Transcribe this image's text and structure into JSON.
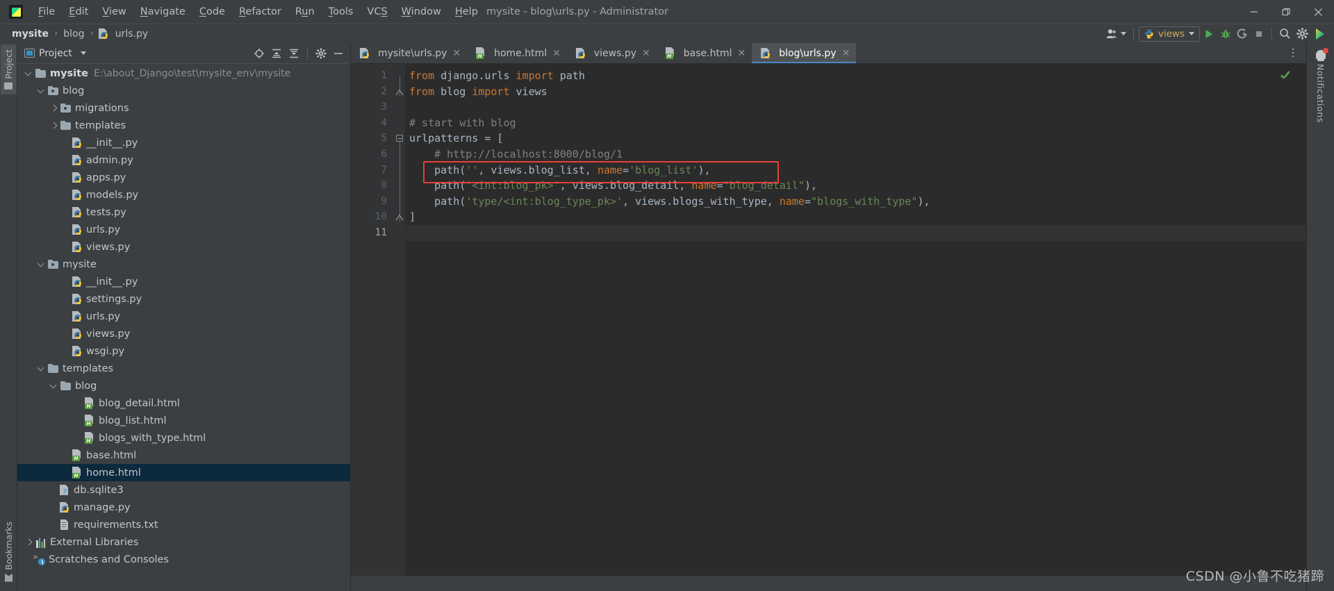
{
  "window": {
    "title": "mysite - blog\\urls.py - Administrator",
    "logo": "pycharm-logo",
    "controls": {
      "minimize": "—",
      "maximize": "❐",
      "close": "✕"
    }
  },
  "menu": [
    {
      "label": "File",
      "mnemonic": "F"
    },
    {
      "label": "Edit",
      "mnemonic": "E"
    },
    {
      "label": "View",
      "mnemonic": "V"
    },
    {
      "label": "Navigate",
      "mnemonic": "N"
    },
    {
      "label": "Code",
      "mnemonic": "C"
    },
    {
      "label": "Refactor",
      "mnemonic": "R"
    },
    {
      "label": "Run",
      "mnemonic": "u"
    },
    {
      "label": "Tools",
      "mnemonic": "T"
    },
    {
      "label": "VCS",
      "mnemonic": "S"
    },
    {
      "label": "Window",
      "mnemonic": "W"
    },
    {
      "label": "Help",
      "mnemonic": "H"
    }
  ],
  "breadcrumb": {
    "items": [
      "mysite",
      "blog",
      "urls.py"
    ],
    "separator": "›"
  },
  "toolbar": {
    "account_icon": "user-account-icon",
    "run_config": {
      "label": "views",
      "icon": "python-icon"
    },
    "run_icon": "run-icon",
    "debug_icon": "debug-bug-icon",
    "coverage_icon": "run-with-coverage-icon",
    "stop_icon": "stop-icon",
    "search_icon": "search-icon",
    "settings_icon": "settings-gear-icon",
    "updates_icon": "ide-updates-icon"
  },
  "left_stripe": {
    "top": {
      "label": "Project",
      "icon": "project-folder-icon",
      "active": true
    },
    "bottom": {
      "label": "Bookmarks",
      "icon": "bookmark-icon",
      "active": false
    }
  },
  "right_stripe": {
    "notifications": {
      "label": "Notifications",
      "icon": "bell-icon",
      "has_badge": true
    }
  },
  "project_panel": {
    "title": "Project",
    "title_icon": "project-view-icon",
    "actions": [
      {
        "name": "select-opened-file-icon",
        "glyph": "⊕"
      },
      {
        "name": "expand-all-icon",
        "glyph": "↑"
      },
      {
        "name": "collapse-all-icon",
        "glyph": "↓"
      },
      {
        "name": "options-gear-icon",
        "glyph": "⚙"
      },
      {
        "name": "hide-icon",
        "glyph": "—"
      }
    ],
    "tree": [
      {
        "label": "mysite",
        "path": "E:\\about_Django\\test\\mysite_env\\mysite",
        "indent": 0,
        "arrow": "down",
        "icon": "folder",
        "bold": true
      },
      {
        "label": "blog",
        "indent": 1,
        "arrow": "down",
        "icon": "folder-src"
      },
      {
        "label": "migrations",
        "indent": 2,
        "arrow": "right",
        "icon": "folder-src"
      },
      {
        "label": "templates",
        "indent": 2,
        "arrow": "right",
        "icon": "folder"
      },
      {
        "label": "__init__.py",
        "indent": 3,
        "arrow": "none",
        "icon": "python"
      },
      {
        "label": "admin.py",
        "indent": 3,
        "arrow": "none",
        "icon": "python"
      },
      {
        "label": "apps.py",
        "indent": 3,
        "arrow": "none",
        "icon": "python"
      },
      {
        "label": "models.py",
        "indent": 3,
        "arrow": "none",
        "icon": "python"
      },
      {
        "label": "tests.py",
        "indent": 3,
        "arrow": "none",
        "icon": "python"
      },
      {
        "label": "urls.py",
        "indent": 3,
        "arrow": "none",
        "icon": "python"
      },
      {
        "label": "views.py",
        "indent": 3,
        "arrow": "none",
        "icon": "python"
      },
      {
        "label": "mysite",
        "indent": 1,
        "arrow": "down",
        "icon": "folder-src"
      },
      {
        "label": "__init__.py",
        "indent": 3,
        "arrow": "none",
        "icon": "python"
      },
      {
        "label": "settings.py",
        "indent": 3,
        "arrow": "none",
        "icon": "python"
      },
      {
        "label": "urls.py",
        "indent": 3,
        "arrow": "none",
        "icon": "python"
      },
      {
        "label": "views.py",
        "indent": 3,
        "arrow": "none",
        "icon": "python"
      },
      {
        "label": "wsgi.py",
        "indent": 3,
        "arrow": "none",
        "icon": "python"
      },
      {
        "label": "templates",
        "indent": 1,
        "arrow": "down",
        "icon": "folder"
      },
      {
        "label": "blog",
        "indent": 2,
        "arrow": "down",
        "icon": "folder"
      },
      {
        "label": "blog_detail.html",
        "indent": 4,
        "arrow": "none",
        "icon": "html"
      },
      {
        "label": "blog_list.html",
        "indent": 4,
        "arrow": "none",
        "icon": "html"
      },
      {
        "label": "blogs_with_type.html",
        "indent": 4,
        "arrow": "none",
        "icon": "html"
      },
      {
        "label": "base.html",
        "indent": 3,
        "arrow": "none",
        "icon": "html"
      },
      {
        "label": "home.html",
        "indent": 3,
        "arrow": "none",
        "icon": "html",
        "selected": true
      },
      {
        "label": "db.sqlite3",
        "indent": 2,
        "arrow": "none",
        "icon": "db"
      },
      {
        "label": "manage.py",
        "indent": 2,
        "arrow": "none",
        "icon": "python"
      },
      {
        "label": "requirements.txt",
        "indent": 2,
        "arrow": "none",
        "icon": "txt"
      },
      {
        "label": "External Libraries",
        "indent": 0,
        "arrow": "right",
        "icon": "lib"
      },
      {
        "label": "Scratches and Consoles",
        "indent": 0,
        "arrow": "none",
        "icon": "scratches"
      }
    ]
  },
  "editor": {
    "tabs": [
      {
        "label": "mysite\\urls.py",
        "icon": "python-file-icon",
        "active": false,
        "close": "✕"
      },
      {
        "label": "home.html",
        "icon": "html-file-icon",
        "active": false,
        "close": "✕"
      },
      {
        "label": "views.py",
        "icon": "python-file-icon",
        "active": false,
        "close": "✕"
      },
      {
        "label": "base.html",
        "icon": "html-file-icon",
        "active": false,
        "close": "✕"
      },
      {
        "label": "blog\\urls.py",
        "icon": "python-file-icon",
        "active": true,
        "close": "✕"
      }
    ],
    "more_tabs_icon": "more-options-icon",
    "inspection_status_icon": "no-problems-checkmark-icon",
    "line_numbers": [
      1,
      2,
      3,
      4,
      5,
      6,
      7,
      8,
      9,
      10,
      11
    ],
    "current_line": 11,
    "highlight_box": {
      "line": 7,
      "color": "#e8403a"
    },
    "lines": [
      {
        "n": 1,
        "tokens": [
          {
            "t": "from",
            "c": "kw"
          },
          {
            "t": " django.urls ",
            "c": "id"
          },
          {
            "t": "import",
            "c": "kw"
          },
          {
            "t": " path",
            "c": "id"
          }
        ]
      },
      {
        "n": 2,
        "tokens": [
          {
            "t": "from",
            "c": "kw"
          },
          {
            "t": " blog ",
            "c": "id"
          },
          {
            "t": "import",
            "c": "kw"
          },
          {
            "t": " views",
            "c": "id"
          }
        ]
      },
      {
        "n": 3,
        "tokens": []
      },
      {
        "n": 4,
        "tokens": [
          {
            "t": "# start with blog",
            "c": "com"
          }
        ]
      },
      {
        "n": 5,
        "tokens": [
          {
            "t": "urlpatterns = [",
            "c": "id"
          }
        ]
      },
      {
        "n": 6,
        "tokens": [
          {
            "t": "    # http://localhost:8000/blog/1",
            "c": "com"
          }
        ]
      },
      {
        "n": 7,
        "tokens": [
          {
            "t": "    path(",
            "c": "id"
          },
          {
            "t": "''",
            "c": "str"
          },
          {
            "t": ", views.blog_list, ",
            "c": "id"
          },
          {
            "t": "name",
            "c": "kw"
          },
          {
            "t": "=",
            "c": "id"
          },
          {
            "t": "'blog_list'",
            "c": "str"
          },
          {
            "t": "),",
            "c": "id"
          }
        ]
      },
      {
        "n": 8,
        "tokens": [
          {
            "t": "    path(",
            "c": "id"
          },
          {
            "t": "'<int:blog_pk>'",
            "c": "str"
          },
          {
            "t": ", views.blog_detail, ",
            "c": "id"
          },
          {
            "t": "name",
            "c": "kw"
          },
          {
            "t": "=",
            "c": "id"
          },
          {
            "t": "\"blog_detail\"",
            "c": "str"
          },
          {
            "t": "),",
            "c": "id"
          }
        ]
      },
      {
        "n": 9,
        "tokens": [
          {
            "t": "    path(",
            "c": "id"
          },
          {
            "t": "'type/<int:blog_type_pk>'",
            "c": "str"
          },
          {
            "t": ", views.blogs_with_type, ",
            "c": "id"
          },
          {
            "t": "name",
            "c": "kw"
          },
          {
            "t": "=",
            "c": "id"
          },
          {
            "t": "\"blogs_with_type\"",
            "c": "str"
          },
          {
            "t": "),",
            "c": "id"
          }
        ]
      },
      {
        "n": 10,
        "tokens": [
          {
            "t": "]",
            "c": "id"
          }
        ]
      },
      {
        "n": 11,
        "tokens": []
      }
    ]
  },
  "watermark": "CSDN @小鲁不吃猪蹄"
}
